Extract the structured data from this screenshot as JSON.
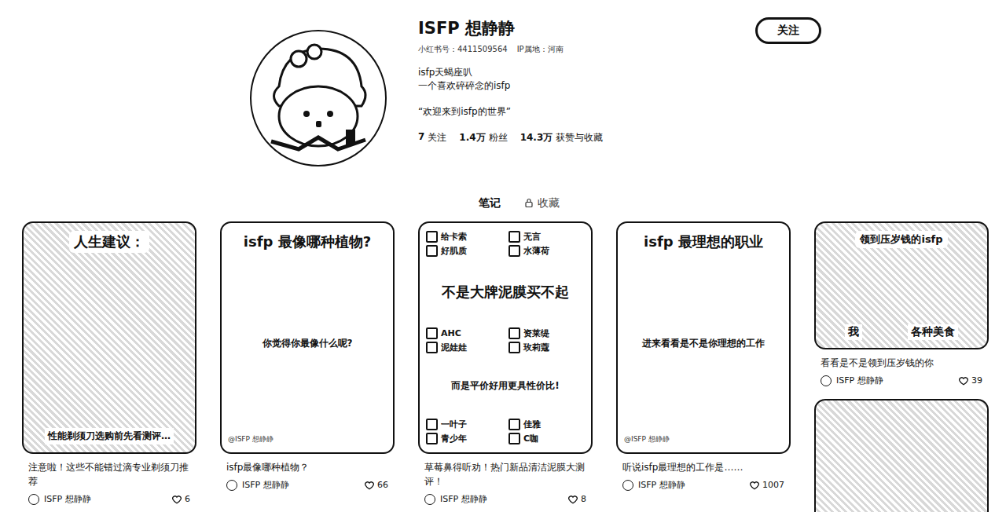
{
  "profile": {
    "name": "ISFP 想静静",
    "account": "小红书号：4411509564",
    "ip": "IP属地：河南",
    "bio": [
      "isfp天蝎座叭",
      "一个喜欢碎碎念的isfp"
    ],
    "quote": "“欢迎来到isfp的世界”",
    "stats": [
      {
        "value": "7",
        "label": "关注"
      },
      {
        "value": "1.4万",
        "label": "粉丝"
      },
      {
        "value": "14.3万",
        "label": "获赞与收藏"
      }
    ],
    "follow_button": "关注"
  },
  "tabs": [
    {
      "label": "笔记",
      "selected": true,
      "locked": false
    },
    {
      "label": "收藏",
      "selected": false,
      "locked": true
    }
  ],
  "notes": [
    {
      "kind": "photo",
      "cover": {
        "title": "人生建议：",
        "subtitle": "性能剃须刀选购前先看测评…",
        "watermark": "",
        "checks": [],
        "labels": []
      },
      "title": "注意啦！这些不能错过滴专业剃须刀推荐",
      "author": "ISFP 想静静",
      "likes": "6"
    },
    {
      "kind": "poster",
      "cover": {
        "title": "isfp 最像哪种植物?",
        "subtitle": "你觉得你最像什么呢?",
        "watermark": "@ISFP 想静静",
        "checks": [],
        "labels": []
      },
      "title": "isfp最像哪种植物？",
      "author": "ISFP 想静静",
      "likes": "66"
    },
    {
      "kind": "poster",
      "cover": {
        "title": "不是大牌泥膜买不起",
        "subtitle": "而是平价好用更具性价比!",
        "watermark": "",
        "checks": [
          "给卡索",
          "无言",
          "好肌质",
          "水薄荷",
          "AHC",
          "资莱缇",
          "泥娃娃",
          "玫莉蔻",
          "一叶子",
          "佳雅",
          "青少年",
          "C咖"
        ],
        "labels": []
      },
      "title": "草莓鼻得听劝！热门新品清洁泥膜大测评！",
      "author": "ISFP 想静静",
      "likes": "8"
    },
    {
      "kind": "poster",
      "cover": {
        "title": "isfp 最理想的职业",
        "subtitle": "进来看看是不是你理想的工作",
        "watermark": "@ISFP 想静静",
        "checks": [],
        "labels": []
      },
      "title": "听说isfp最理想的工作是……",
      "author": "ISFP 想静静",
      "likes": "1007"
    },
    {
      "kind": "banner",
      "cover": {
        "title": "领到压岁钱的isfp",
        "subtitle": "",
        "watermark": "",
        "checks": [],
        "labels": [
          "我",
          "各种美食"
        ]
      },
      "title": "看看是不是领到压岁钱的你",
      "author": "ISFP 想静静",
      "likes": "39"
    },
    {
      "kind": "photo",
      "cover": {
        "title": "",
        "subtitle": "",
        "watermark": "",
        "checks": [],
        "labels": []
      },
      "title": "",
      "author": "",
      "likes": ""
    }
  ]
}
